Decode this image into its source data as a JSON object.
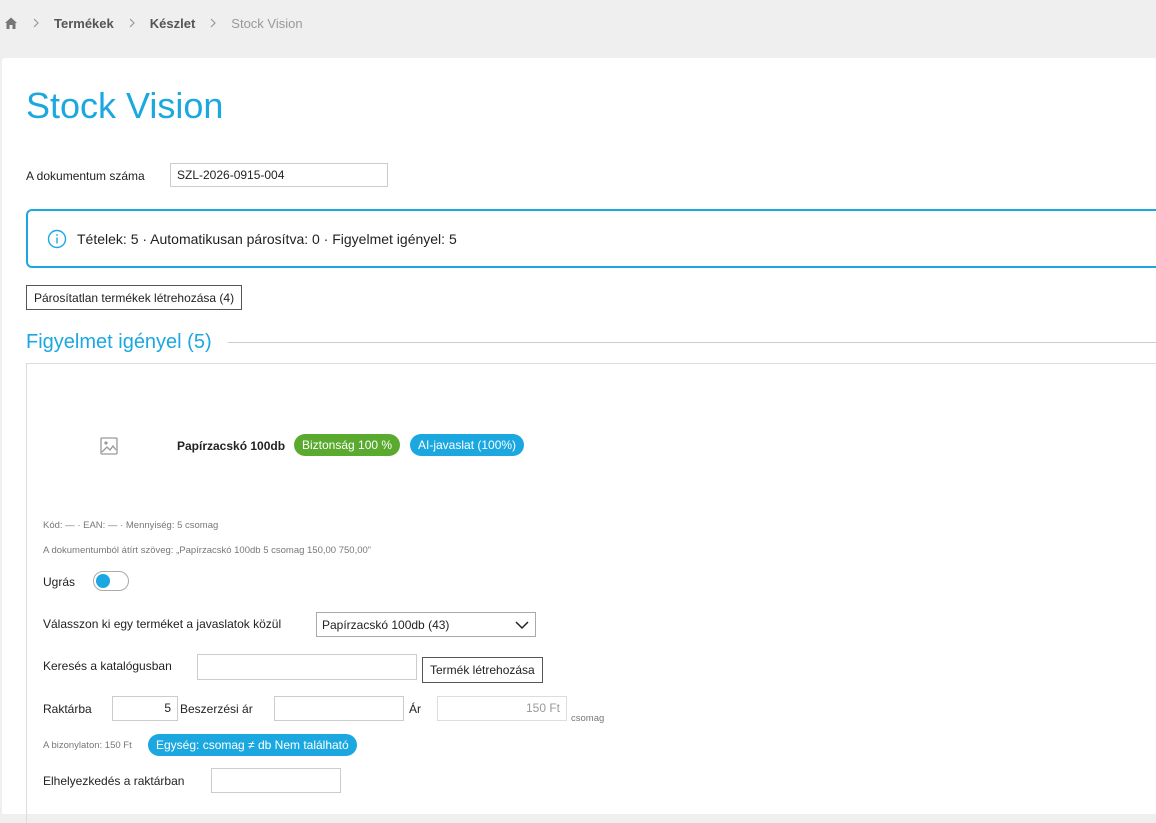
{
  "breadcrumb": {
    "home_icon": "home-icon",
    "items": [
      "Termékek",
      "Készlet"
    ],
    "current": "Stock Vision"
  },
  "page": {
    "title": "Stock Vision",
    "doc_number_label": "A dokumentum száma",
    "doc_number_value": "SZL-2026-0915-004"
  },
  "info": {
    "icon": "info-icon",
    "text": "Tételek: 5 · Automatikusan párosítva: 0 · Figyelmet igényel: 5"
  },
  "actions": {
    "create_unmatched_label": "Párosítatlan termékek létrehozása (4)"
  },
  "section": {
    "title": "Figyelmet igényel (5)"
  },
  "item": {
    "image_icon": "image-placeholder-icon",
    "name": "Papírzacskó 100db",
    "badge_confidence": "Biztonság 100 %",
    "badge_ai": "AI-javaslat (100%)",
    "meta_line": "Kód: — · EAN: — · Mennyiség: 5 csomag",
    "source_text": "A dokumentumból átírt szöveg: „Papírzacskó 100db 5 csomag 150,00 750,00”",
    "skip_label": "Ugrás",
    "skip_on": true,
    "suggestion_label": "Válasszon ki egy terméket a javaslatok közül",
    "suggestion_selected": "Papírzacskó 100db (43)",
    "catalog_search_label": "Keresés a katalógusban",
    "catalog_search_value": "",
    "create_product_label": "Termék létrehozása",
    "stock_label": "Raktárba",
    "stock_value": "5",
    "cost_label": "Beszerzési ár",
    "cost_value": "",
    "price_label": "Ár",
    "price_value": "150 Ft",
    "unit": "csomag",
    "doc_price": "A bizonylaton: 150 Ft",
    "unit_badge": "Egység: csomag ≠ db Nem található",
    "location_label": "Elhelyezkedés a raktárban",
    "location_value": ""
  },
  "colors": {
    "accent": "#1ba8e0",
    "success": "#5aaa2f"
  }
}
